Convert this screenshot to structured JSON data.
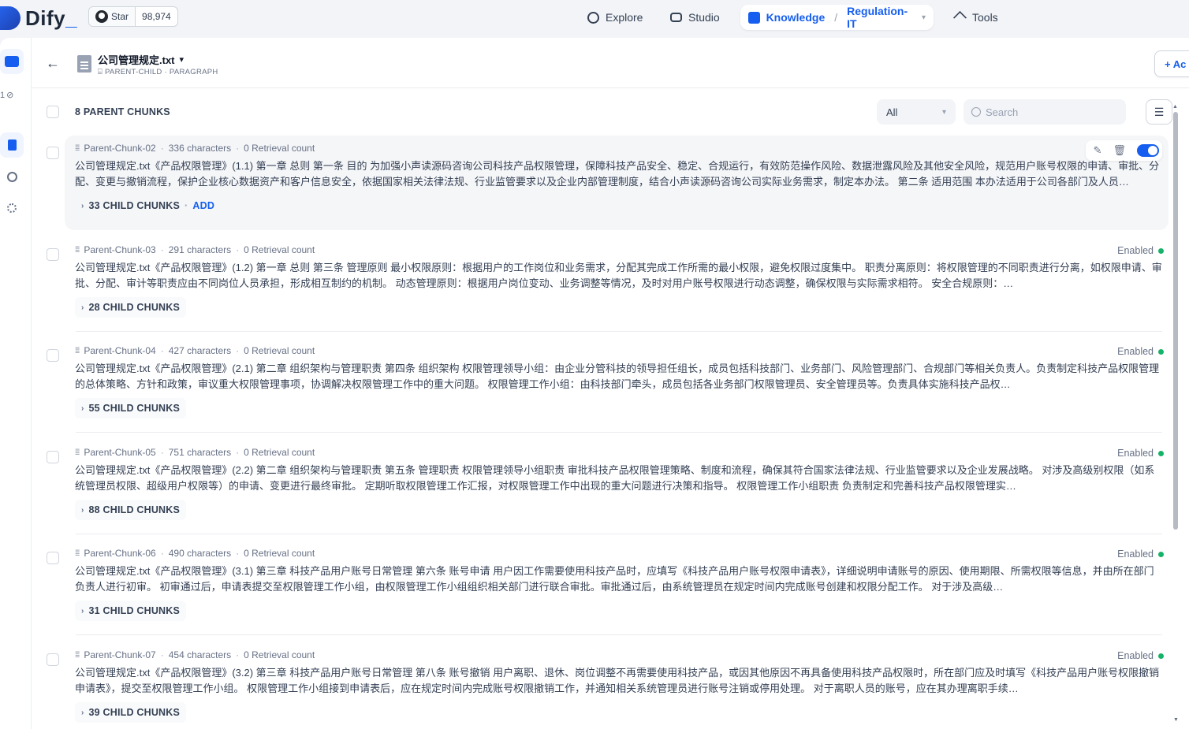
{
  "brand": {
    "name": "Dify",
    "suffix": "_"
  },
  "github": {
    "star_label": "Star",
    "star_count": "98,974"
  },
  "nav": {
    "explore": "Explore",
    "studio": "Studio",
    "knowledge": "Knowledge",
    "knowledge_sep": "/",
    "dataset": "Regulation-IT",
    "tools": "Tools"
  },
  "rail": {
    "count": "1"
  },
  "document": {
    "title": "公司管理规定.txt",
    "mode": "PARENT-CHILD · PARAGRAPH",
    "add_button": "+ Ac"
  },
  "toolbar": {
    "count_label": "8 PARENT CHUNKS",
    "filter_value": "All",
    "search_placeholder": "Search"
  },
  "chunks": [
    {
      "id": "Parent-Chunk-02",
      "chars": "336 characters",
      "retrieval": "0 Retrieval count",
      "text": "公司管理规定.txt《产品权限管理》(1.1) 第一章 总则 第一条 目的 为加强小声读源码咨询公司科技产品权限管理，保障科技产品安全、稳定、合规运行，有效防范操作风险、数据泄露风险及其他安全风险，规范用户账号权限的申请、审批、分配、变更与撤销流程，保护企业核心数据资产和客户信息安全，依据国家相关法律法规、行业监管要求以及企业内部管理制度，结合小声读源码咨询公司实际业务需求，制定本办法。 第二条 适用范围 本办法适用于公司各部门及人员…",
      "children": "33 CHILD CHUNKS",
      "add": "ADD",
      "status": ""
    },
    {
      "id": "Parent-Chunk-03",
      "chars": "291 characters",
      "retrieval": "0 Retrieval count",
      "text": "公司管理规定.txt《产品权限管理》(1.2) 第一章 总则 第三条 管理原则 最小权限原则：根据用户的工作岗位和业务需求，分配其完成工作所需的最小权限，避免权限过度集中。 职责分离原则：将权限管理的不同职责进行分离，如权限申请、审批、分配、审计等职责应由不同岗位人员承担，形成相互制约的机制。 动态管理原则：根据用户岗位变动、业务调整等情况，及时对用户账号权限进行动态调整，确保权限与实际需求相符。 安全合规原则：…",
      "children": "28 CHILD CHUNKS",
      "add": "",
      "status": "Enabled"
    },
    {
      "id": "Parent-Chunk-04",
      "chars": "427 characters",
      "retrieval": "0 Retrieval count",
      "text": "公司管理规定.txt《产品权限管理》(2.1) 第二章 组织架构与管理职责 第四条 组织架构 权限管理领导小组：由企业分管科技的领导担任组长，成员包括科技部门、业务部门、风险管理部门、合规部门等相关负责人。负责制定科技产品权限管理的总体策略、方针和政策，审议重大权限管理事项，协调解决权限管理工作中的重大问题。 权限管理工作小组：由科技部门牵头，成员包括各业务部门权限管理员、安全管理员等。负责具体实施科技产品权…",
      "children": "55 CHILD CHUNKS",
      "add": "",
      "status": "Enabled"
    },
    {
      "id": "Parent-Chunk-05",
      "chars": "751 characters",
      "retrieval": "0 Retrieval count",
      "text": "公司管理规定.txt《产品权限管理》(2.2) 第二章 组织架构与管理职责 第五条 管理职责 权限管理领导小组职责 审批科技产品权限管理策略、制度和流程，确保其符合国家法律法规、行业监管要求以及企业发展战略。 对涉及高级别权限（如系统管理员权限、超级用户权限等）的申请、变更进行最终审批。 定期听取权限管理工作汇报，对权限管理工作中出现的重大问题进行决策和指导。 权限管理工作小组职责 负责制定和完善科技产品权限管理实…",
      "children": "88 CHILD CHUNKS",
      "add": "",
      "status": "Enabled"
    },
    {
      "id": "Parent-Chunk-06",
      "chars": "490 characters",
      "retrieval": "0 Retrieval count",
      "text": "公司管理规定.txt《产品权限管理》(3.1) 第三章 科技产品用户账号日常管理 第六条 账号申请 用户因工作需要使用科技产品时，应填写《科技产品用户账号权限申请表》，详细说明申请账号的原因、使用期限、所需权限等信息，并由所在部门负责人进行初审。 初审通过后，申请表提交至权限管理工作小组，由权限管理工作小组组织相关部门进行联合审批。审批通过后，由系统管理员在规定时间内完成账号创建和权限分配工作。 对于涉及高级…",
      "children": "31 CHILD CHUNKS",
      "add": "",
      "status": "Enabled"
    },
    {
      "id": "Parent-Chunk-07",
      "chars": "454 characters",
      "retrieval": "0 Retrieval count",
      "text": "公司管理规定.txt《产品权限管理》(3.2) 第三章 科技产品用户账号日常管理 第八条 账号撤销 用户离职、退休、岗位调整不再需要使用科技产品，或因其他原因不再具备使用科技产品权限时，所在部门应及时填写《科技产品用户账号权限撤销申请表》，提交至权限管理工作小组。 权限管理工作小组接到申请表后，应在规定时间内完成账号权限撤销工作，并通知相关系统管理员进行账号注销或停用处理。 对于离职人员的账号，应在其办理离职手续…",
      "children": "39 CHILD CHUNKS",
      "add": "",
      "status": "Enabled"
    }
  ]
}
